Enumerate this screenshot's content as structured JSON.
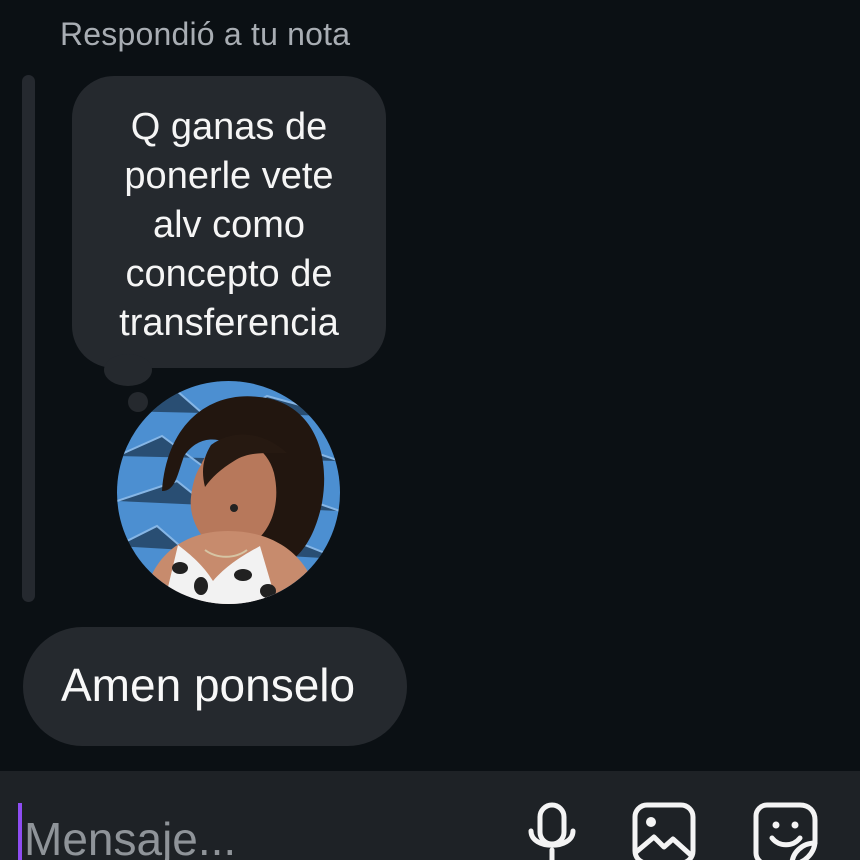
{
  "reply": {
    "label": "Respondió a tu nota"
  },
  "note": {
    "lines": [
      "Q ganas de",
      "ponerle vete",
      "alv como",
      "concepto de",
      "transferencia"
    ]
  },
  "avatar": {
    "description": "profile photo",
    "icon": "avatar-photo"
  },
  "message": {
    "text": "Amen ponselo"
  },
  "composer": {
    "placeholder": "Mensaje...",
    "value": "",
    "accent_color": "#8e4df2",
    "icons": {
      "mic": "microphone-icon",
      "gallery": "gallery-icon",
      "sticker": "sticker-icon"
    }
  },
  "colors": {
    "background": "#0b1014",
    "bubble": "#25292e",
    "composer": "#1e2226",
    "text": "#f4f4f4",
    "muted_text": "#a8adb3"
  }
}
